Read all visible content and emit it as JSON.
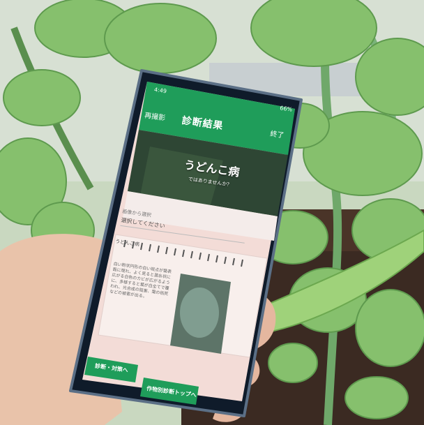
{
  "colors": {
    "app_green": "#1f9d5a",
    "pink_panel": "#f6dcd8"
  },
  "phone": {
    "status_bar": {
      "time": "4:49",
      "battery": "66%"
    },
    "app_bar": {
      "left_label": "再撮影",
      "title": "診断結果",
      "right_label": "終了"
    },
    "hero": {
      "title": "うどんこ病",
      "subtitle": "ではありませんか？"
    },
    "selector": {
      "label": "画像から選択",
      "placeholder": "選択してください"
    },
    "result_card": {
      "disease_name": "うどんこ病",
      "description": "白い粉状円形の白い斑点が葉表面に現れ、よく見ると菌糸状に広がる白色のカビが広がるように、多様すると葉が白全てで覆われ、光合成の阻害、葉の枯死などの被害が出る。"
    },
    "buttons": {
      "primary": "診断・対策へ",
      "secondary": "作物別診断トップへ"
    },
    "nav_icons": [
      "recent-apps-icon",
      "home-icon",
      "back-icon"
    ]
  }
}
